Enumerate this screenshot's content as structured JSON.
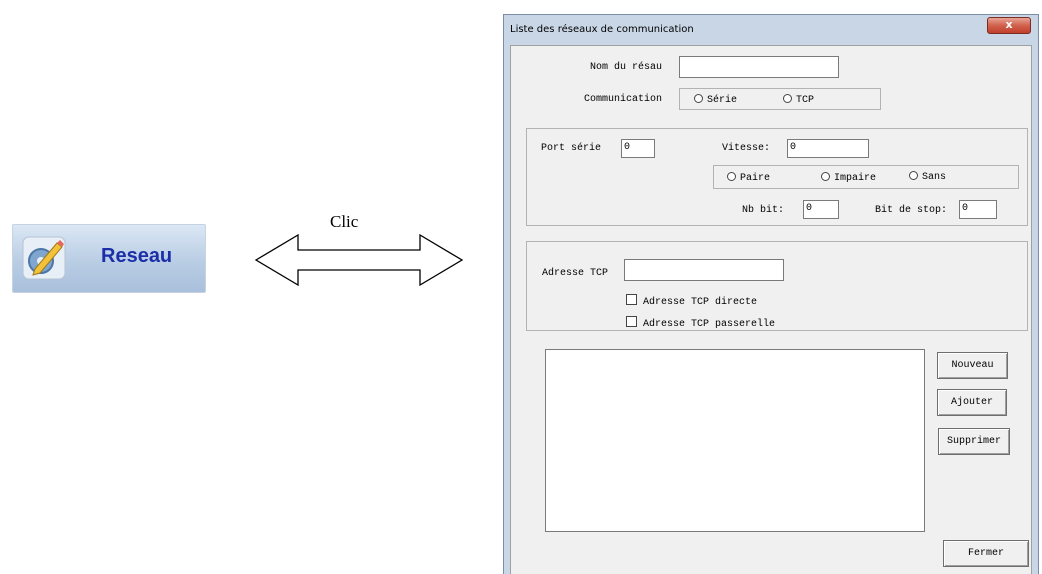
{
  "left_panel": {
    "reseau_button_label": "Reseau",
    "clic_label": "Clic",
    "icon": "pencil-gear-icon"
  },
  "window": {
    "title": "Liste des réseaux de communication",
    "close_symbol": "x",
    "nom_label": "Nom du résau",
    "nom_value": "",
    "communication_label": "Communication",
    "comm_options": [
      "Série",
      "TCP"
    ],
    "port_serie_label": "Port série",
    "port_serie_value": "0",
    "vitesse_label": "Vitesse:",
    "vitesse_value": "0",
    "parity_options": [
      "Paire",
      "Impaire",
      "Sans"
    ],
    "nb_bit_label": "Nb bit:",
    "nb_bit_value": "0",
    "bit_stop_label": "Bit de stop:",
    "bit_stop_value": "0",
    "adresse_tcp_label": "Adresse TCP",
    "adresse_tcp_value": "",
    "check_directe": "Adresse TCP directe",
    "check_passerelle": "Adresse TCP passerelle",
    "buttons": {
      "nouveau": "Nouveau",
      "ajouter": "Ajouter",
      "supprimer": "Supprimer",
      "fermer": "Fermer"
    }
  },
  "colors": {
    "window_frame": "#c9d6e6",
    "close_button": "#c94f3a",
    "reseau_text": "#1d2fa8"
  }
}
